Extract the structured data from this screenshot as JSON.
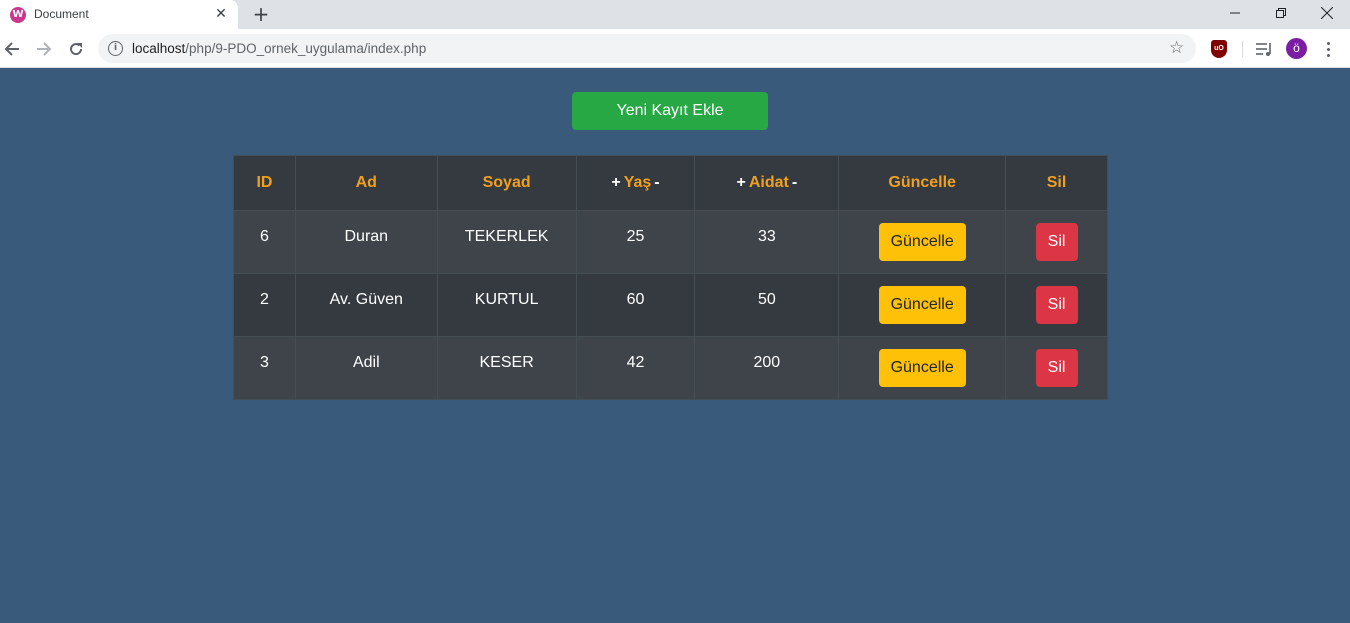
{
  "browser": {
    "tab_title": "Document",
    "favicon_letter": "W",
    "url_host": "localhost",
    "url_path": "/php/9-PDO_ornek_uygulama/index.php",
    "extension_label": "uO",
    "avatar_letter": "ö"
  },
  "page": {
    "add_button": "Yeni Kayıt Ekle",
    "table": {
      "headers": {
        "id": "ID",
        "ad": "Ad",
        "soyad": "Soyad",
        "yas": "Yaş",
        "aidat": "Aidat",
        "guncelle": "Güncelle",
        "sil": "Sil"
      },
      "sort_plus": "+",
      "sort_minus": "-",
      "rows": [
        {
          "id": "6",
          "ad": "Duran",
          "soyad": "TEKERLEK",
          "yas": "25",
          "aidat": "33",
          "update_label": "Güncelle",
          "delete_label": "Sil"
        },
        {
          "id": "2",
          "ad": "Av. Güven",
          "soyad": "KURTUL",
          "yas": "60",
          "aidat": "50",
          "update_label": "Güncelle",
          "delete_label": "Sil"
        },
        {
          "id": "3",
          "ad": "Adil",
          "soyad": "KESER",
          "yas": "42",
          "aidat": "200",
          "update_label": "Güncelle",
          "delete_label": "Sil"
        }
      ]
    }
  },
  "colors": {
    "page_bg": "#3a5a7c",
    "add_button": "#28a745",
    "header_text": "#f0a020",
    "update_button": "#ffc107",
    "delete_button": "#dc3545"
  }
}
